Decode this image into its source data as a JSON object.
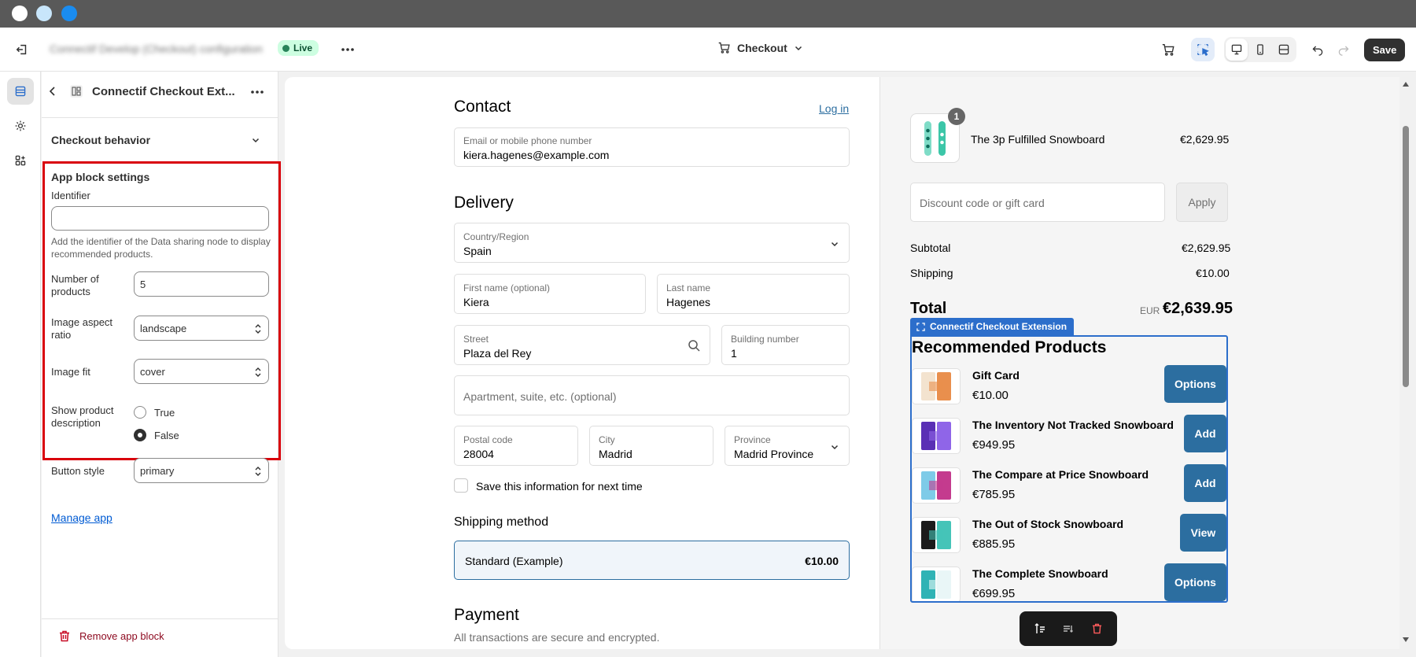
{
  "window": {
    "dots": [
      "#ffffff",
      "#c8e6fb",
      "#1a8cf0"
    ]
  },
  "topbar": {
    "configuration_title": "Connectif Develop (Checkout) configuration",
    "live_label": "Live",
    "page_selector": "Checkout",
    "save_label": "Save"
  },
  "panel": {
    "block_title": "Connectif Checkout Ext...",
    "section_title": "Checkout behavior",
    "settings_heading": "App block settings",
    "identifier": {
      "label": "Identifier",
      "value": "",
      "help": "Add the identifier of the Data sharing node to display recommended products."
    },
    "number_of_products": {
      "label": "Number of products",
      "value": "5"
    },
    "image_aspect_ratio": {
      "label": "Image aspect ratio",
      "value": "landscape"
    },
    "image_fit": {
      "label": "Image fit",
      "value": "cover"
    },
    "show_description": {
      "label": "Show product description",
      "options": [
        "True",
        "False"
      ],
      "selected": "False"
    },
    "button_style": {
      "label": "Button style",
      "value": "primary"
    },
    "manage_app": "Manage app",
    "remove_block": "Remove app block"
  },
  "checkout": {
    "contact_heading": "Contact",
    "login_link": "Log in",
    "email": {
      "label": "Email or mobile phone number",
      "value": "kiera.hagenes@example.com"
    },
    "delivery_heading": "Delivery",
    "country": {
      "label": "Country/Region",
      "value": "Spain"
    },
    "first_name": {
      "label": "First name (optional)",
      "value": "Kiera"
    },
    "last_name": {
      "label": "Last name",
      "value": "Hagenes"
    },
    "street": {
      "label": "Street",
      "value": "Plaza del Rey"
    },
    "building": {
      "label": "Building number",
      "value": "1"
    },
    "apartment_placeholder": "Apartment, suite, etc. (optional)",
    "postal": {
      "label": "Postal code",
      "value": "28004"
    },
    "city": {
      "label": "City",
      "value": "Madrid"
    },
    "province": {
      "label": "Province",
      "value": "Madrid Province"
    },
    "save_info": "Save this information for next time",
    "shipping_heading": "Shipping method",
    "shipping_option": {
      "name": "Standard (Example)",
      "price": "€10.00"
    },
    "payment_heading": "Payment",
    "payment_subtitle": "All transactions are secure and encrypted."
  },
  "summary": {
    "item": {
      "name": "The 3p Fulfilled Snowboard",
      "price": "€2,629.95",
      "qty": "1"
    },
    "discount_placeholder": "Discount code or gift card",
    "apply_label": "Apply",
    "subtotal_label": "Subtotal",
    "subtotal_value": "€2,629.95",
    "shipping_label": "Shipping",
    "shipping_value": "€10.00",
    "total_label": "Total",
    "currency": "EUR",
    "total_value": "€2,639.95"
  },
  "extension": {
    "tag": "Connectif Checkout Extension",
    "heading": "Recommended Products",
    "products": [
      {
        "name": "Gift Card",
        "price": "€10.00",
        "button": "Options"
      },
      {
        "name": "The Inventory Not Tracked Snowboard",
        "price": "€949.95",
        "button": "Add"
      },
      {
        "name": "The Compare at Price Snowboard",
        "price": "€785.95",
        "button": "Add"
      },
      {
        "name": "The Out of Stock Snowboard",
        "price": "€885.95",
        "button": "View"
      },
      {
        "name": "The Complete Snowboard",
        "price": "€699.95",
        "button": "Options"
      }
    ]
  },
  "colors": {
    "accent_blue": "#2c6ea0",
    "selection_blue": "#2c6ecb",
    "highlight_red": "#d9000b"
  }
}
